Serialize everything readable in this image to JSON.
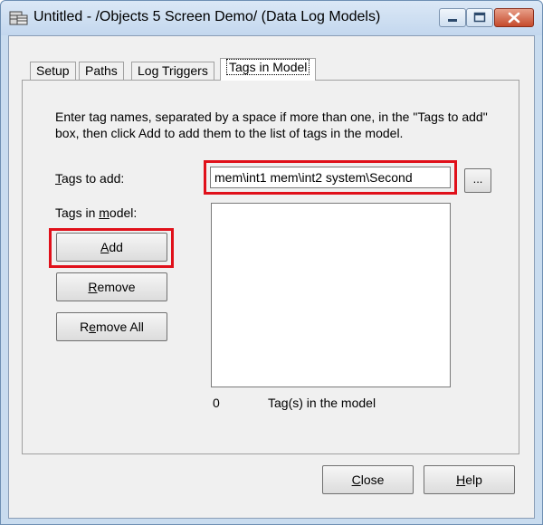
{
  "window": {
    "title": "Untitled - /Objects 5 Screen Demo/ (Data Log Models)",
    "controls": {
      "minimize": "minimize-icon",
      "maximize": "maximize-icon",
      "close": "close-icon"
    }
  },
  "tabs": [
    {
      "label": "Setup",
      "active": false
    },
    {
      "label": "Paths",
      "active": false
    },
    {
      "label": "Log Triggers",
      "active": false
    },
    {
      "label": "Tags in Model",
      "active": true
    }
  ],
  "panel": {
    "instructions": "Enter tag names, separated by a space if more than one, in the \"Tags to add\" box, then click Add to add them to the list of tags in the model.",
    "tags_to_add_label": {
      "mnemonic": "T",
      "rest": "ags to add:"
    },
    "tags_to_add_value": "mem\\int1 mem\\int2 system\\Second",
    "browse_label": "...",
    "tags_in_model_label": {
      "pre": "Tags in ",
      "mnemonic": "m",
      "rest": "odel:"
    },
    "add_button": {
      "mnemonic": "A",
      "rest": "dd"
    },
    "remove_button": {
      "mnemonic": "R",
      "rest": "emove"
    },
    "remove_all_button": {
      "pre": "R",
      "mnemonic": "e",
      "rest": "move All"
    },
    "tag_list": [],
    "tag_count": "0",
    "tag_count_label": "Tag(s) in the model"
  },
  "footer": {
    "close_button": {
      "mnemonic": "C",
      "rest": "lose"
    },
    "help_button": {
      "mnemonic": "H",
      "rest": "elp"
    }
  },
  "colors": {
    "highlight": "#e0101a",
    "title_bar": "#c9dcef",
    "dialog_bg": "#f0f0f0"
  }
}
